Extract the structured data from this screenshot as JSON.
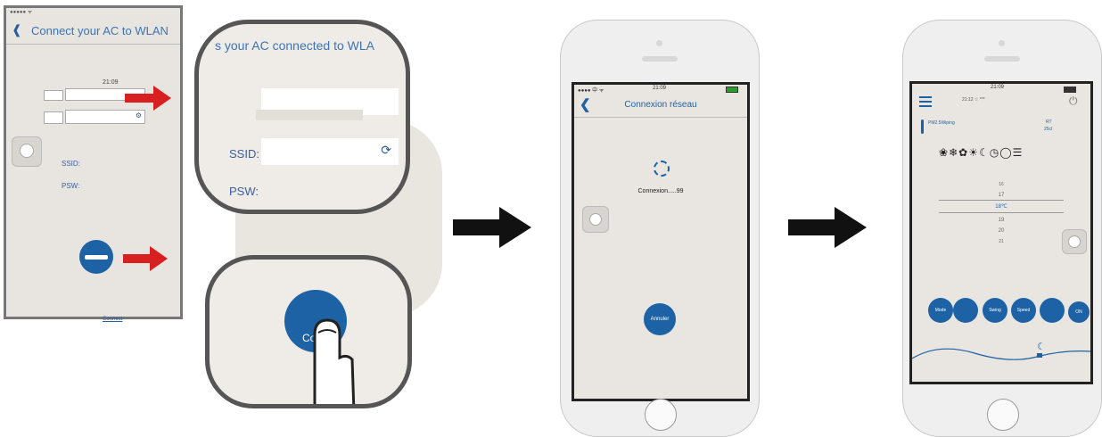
{
  "panel1": {
    "status_text": "●●●●● ᯤ",
    "back_icon": "chevron-left-icon",
    "title": "Connect your AC to WLAN",
    "time": "21:09",
    "ssid_label": "SSID:",
    "psw_label": "PSW:",
    "connect_caption": "Connect"
  },
  "zoom1": {
    "heading": "s your AC connected to WLA",
    "ssid_label": "SSID:",
    "psw_label": "PSW:"
  },
  "zoom2": {
    "button_label": "Co"
  },
  "phone1": {
    "carrier": "●●●● 中 ᯤ",
    "time": "21:09",
    "title": "Connexion réseau",
    "connecting_text": "Connexion.....99",
    "cancel_label": "Annuler"
  },
  "phone2": {
    "time": "21:09",
    "header_small": "21:12  ☆ ***",
    "pm_label": "PM2.5Wiping",
    "rt_label": "RT",
    "rt_value": "25cl",
    "temps": [
      "16",
      "17",
      "18℃",
      "19",
      "20",
      "21"
    ],
    "buttons": [
      "Mode",
      "",
      "Swing",
      "Speed",
      "",
      "ON"
    ]
  },
  "colors": {
    "accent_blue": "#1d62a5",
    "arrow_red": "#d92020",
    "arrow_black": "#111111"
  }
}
